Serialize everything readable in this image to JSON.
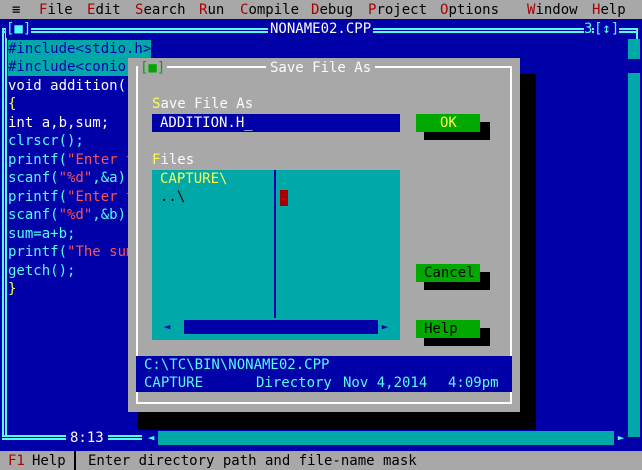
{
  "menu": {
    "system": "≡",
    "items": [
      {
        "label": "File",
        "hot": "F",
        "rest": "ile"
      },
      {
        "label": "Edit",
        "hot": "E",
        "rest": "dit"
      },
      {
        "label": "Search",
        "hot": "S",
        "rest": "earch"
      },
      {
        "label": "Run",
        "hot": "R",
        "rest": "un"
      },
      {
        "label": "Compile",
        "hot": "C",
        "rest": "ompile"
      },
      {
        "label": "Debug",
        "hot": "D",
        "rest": "ebug"
      },
      {
        "label": "Project",
        "hot": "P",
        "rest": "roject"
      },
      {
        "label": "Options",
        "hot": "O",
        "rest": "ptions"
      },
      {
        "label": "Window",
        "hot": "W",
        "rest": "indow"
      },
      {
        "label": "Help",
        "hot": "H",
        "rest": "elp"
      }
    ]
  },
  "editor": {
    "close_box": "[■]",
    "title": "NONAME02.CPP",
    "window_number": "3",
    "zoom_box": "[↕]",
    "cursor_pos": "8:13",
    "lines": [
      {
        "pre": "#include<stdio.h>",
        "str": "",
        "post": ""
      },
      {
        "pre": "#include<conio.",
        "str": "",
        "post": ""
      },
      {
        "pre": "void addition()",
        "str": "",
        "post": ""
      },
      {
        "pre": "{",
        "str": "",
        "post": ""
      },
      {
        "pre": "int a,b,sum;",
        "str": "",
        "post": ""
      },
      {
        "pre": "clrscr();",
        "str": "",
        "post": ""
      },
      {
        "pre": "printf(",
        "str": "\"Enter t",
        "post": ""
      },
      {
        "pre": "scanf(",
        "str": "\"%d\"",
        "post": ",&a);"
      },
      {
        "pre": "printf(",
        "str": "\"Enter t",
        "post": ""
      },
      {
        "pre": "scanf(",
        "str": "\"%d\"",
        "post": ",&b);"
      },
      {
        "pre": "sum=a+b;",
        "str": "",
        "post": ""
      },
      {
        "pre": "printf(",
        "str": "\"The sum",
        "post": ""
      },
      {
        "pre": "getch();",
        "str": "",
        "post": ""
      },
      {
        "pre": "}",
        "str": "",
        "post": ""
      }
    ]
  },
  "dialog": {
    "close_box": "[■]",
    "title": "Save File As",
    "save_label_hot": "S",
    "save_label_rest": "ave File As",
    "filename_value": "ADDITION.H_",
    "files_label_hot": "F",
    "files_label_rest": "iles",
    "files": [
      "CAPTURE\\",
      "..\\"
    ],
    "ok_label": "OK",
    "cancel_label": "Cancel",
    "help_label": "Help",
    "info_path": "C:\\TC\\BIN\\NONAME02.CPP",
    "info_name": "CAPTURE",
    "info_type": "Directory",
    "info_date": "Nov 4,2014",
    "info_time": "4:09pm"
  },
  "status": {
    "key": "F1",
    "key_label": "Help",
    "message": "Enter directory path and file-name mask"
  },
  "colors": {
    "desktop_blue": "#0000a8",
    "cyan": "#54fcfc",
    "teal": "#00a8a8",
    "gray": "#a8a8a8",
    "green": "#00a800",
    "yellow": "#fcfc54",
    "red": "#a80000"
  }
}
